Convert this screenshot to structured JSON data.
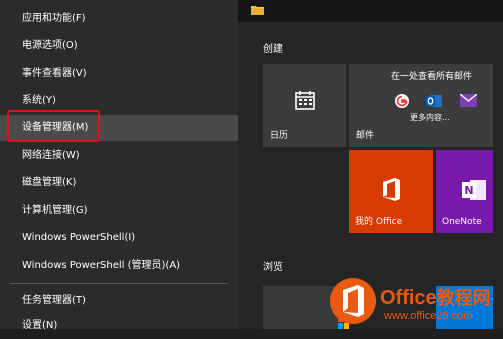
{
  "menu": {
    "items": [
      {
        "label": "应用和功能(F)"
      },
      {
        "label": "电源选项(O)"
      },
      {
        "label": "事件查看器(V)"
      },
      {
        "label": "系统(Y)"
      },
      {
        "label": "设备管理器(M)"
      },
      {
        "label": "网络连接(W)"
      },
      {
        "label": "磁盘管理(K)"
      },
      {
        "label": "计算机管理(G)"
      },
      {
        "label": "Windows PowerShell(I)"
      },
      {
        "label": "Windows PowerShell (管理员)(A)"
      },
      {
        "label": "任务管理器(T)"
      },
      {
        "label": "设置(N)"
      }
    ]
  },
  "start": {
    "group_create": "创建",
    "group_browse": "浏览",
    "calendar_label": "日历",
    "mail_header": "在一处查看所有邮件",
    "mail_more": "更多内容...",
    "mail_label": "邮件",
    "office_label": "我的 Office",
    "onenote_label": "OneNote"
  },
  "watermark": {
    "brand_a": "Office",
    "brand_b": "教程网",
    "url": "www.office26.com"
  },
  "colors": {
    "office_tile": "#d83b01",
    "onenote_tile": "#7719aa",
    "highlight": "#e3101a"
  }
}
